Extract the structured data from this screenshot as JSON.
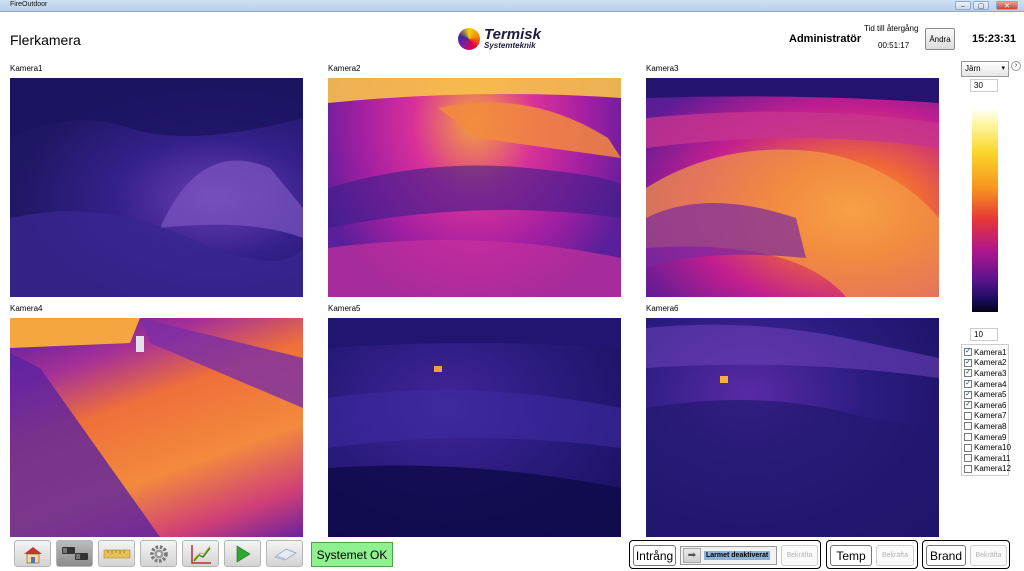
{
  "window": {
    "title": "FireOutdoor",
    "minimize": "–",
    "maximize": "▢",
    "close": "✕"
  },
  "header": {
    "title": "Flerkamera",
    "logo_line1": "Termisk",
    "logo_line2": "Systemteknik",
    "user": "Administratör",
    "time_to_return_label": "Tid till återgång",
    "time_to_return_value": "00:51:17",
    "change_button": "Ändra",
    "clock": "15:23:31"
  },
  "cameras": [
    {
      "label": "Kamera1"
    },
    {
      "label": "Kamera2"
    },
    {
      "label": "Kamera3"
    },
    {
      "label": "Kamera4"
    },
    {
      "label": "Kamera5"
    },
    {
      "label": "Kamera6"
    }
  ],
  "right_panel": {
    "palette": "Järn",
    "palette_arrow": "▾",
    "next_arrow": "›",
    "scale_max": "30",
    "scale_min": "10",
    "camera_list": [
      {
        "label": "Kamera1",
        "checked": true
      },
      {
        "label": "Kamera2",
        "checked": true
      },
      {
        "label": "Kamera3",
        "checked": true
      },
      {
        "label": "Kamera4",
        "checked": true
      },
      {
        "label": "Kamera5",
        "checked": true
      },
      {
        "label": "Kamera6",
        "checked": true
      },
      {
        "label": "Kamera7",
        "checked": false
      },
      {
        "label": "Kamera8",
        "checked": false
      },
      {
        "label": "Kamera9",
        "checked": false
      },
      {
        "label": "Kamera10",
        "checked": false
      },
      {
        "label": "Kamera11",
        "checked": false
      },
      {
        "label": "Kamera12",
        "checked": false
      }
    ]
  },
  "toolbar": {
    "icons": [
      "house-icon",
      "cameras-icon",
      "ruler-icon",
      "gear-icon",
      "chart-icon",
      "play-icon",
      "eraser-icon"
    ],
    "status": "Systemet OK"
  },
  "alarms": {
    "intrusion_label": "Intrång",
    "alarm_arrow": "➡",
    "alarm_deactivated": "Larmet deaktiverat",
    "ack_label": "Bekräfta",
    "temp_label": "Temp",
    "fire_label": "Brand"
  },
  "colors": {
    "status_ok": "#8ff08f",
    "accent": "#8db4d6"
  }
}
